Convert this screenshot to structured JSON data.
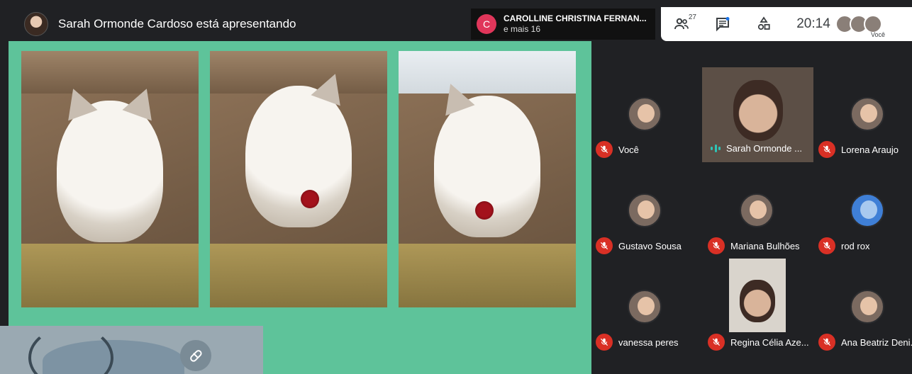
{
  "header": {
    "presenting_text": "Sarah Ormonde Cardoso está apresentando"
  },
  "chat_notice": {
    "initial": "C",
    "name": "CAROLLINE CHRISTINA FERNAN...",
    "more": "e mais 16"
  },
  "controls": {
    "participants_count": "27",
    "time": "20:14",
    "self_label": "Você"
  },
  "participants": [
    {
      "name": "Você",
      "muted": true
    },
    {
      "name": "Sarah Ormonde ...",
      "muted": false,
      "speaking": true
    },
    {
      "name": "Lorena Araujo",
      "muted": true
    },
    {
      "name": "Gustavo Sousa",
      "muted": true
    },
    {
      "name": "Mariana Bulhões",
      "muted": true
    },
    {
      "name": "rod rox",
      "muted": true
    },
    {
      "name": "vanessa peres",
      "muted": true
    },
    {
      "name": "Regina Célia Aze...",
      "muted": true
    },
    {
      "name": "Ana Beatriz Deni...",
      "muted": true
    }
  ],
  "colors": {
    "slide_background": "#5ec39a",
    "meet_background": "#202124",
    "mic_off": "#d93025",
    "chat_avatar": "#e0365a"
  }
}
